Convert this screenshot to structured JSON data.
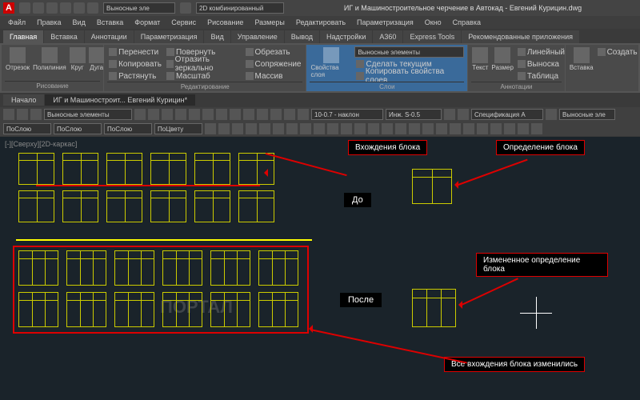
{
  "title": "ИГ и Машиностроительное черчение в Автокад - Евгений Курицин.dwg",
  "logo": "A",
  "qat_combo": "Выносные эле",
  "qat_combo2": "2D комбинированный",
  "menus": [
    "Файл",
    "Правка",
    "Вид",
    "Вставка",
    "Формат",
    "Сервис",
    "Рисование",
    "Размеры",
    "Редактировать",
    "Параметризация",
    "Окно",
    "Справка"
  ],
  "ribbon_tabs": [
    "Главная",
    "Вставка",
    "Аннотации",
    "Параметризация",
    "Вид",
    "Управление",
    "Вывод",
    "Надстройки",
    "A360",
    "Express Tools",
    "Рекомендованные приложения"
  ],
  "panels": {
    "draw": {
      "title": "Рисование",
      "btns": [
        "Отрезок",
        "Полилиния",
        "Круг",
        "Дуга"
      ]
    },
    "edit": {
      "title": "Редактирование",
      "rows": [
        "Перенести",
        "Копировать",
        "Растянуть",
        "Повернуть",
        "Отразить зеркально",
        "Масштаб",
        "Обрезать",
        "Сопряжение",
        "Массив"
      ]
    },
    "layers": {
      "title": "Слои",
      "btn": "Свойства слоя",
      "combo": "Выносные элементы",
      "rows": [
        "Сделать текущим",
        "Копировать свойства слоев"
      ]
    },
    "anno": {
      "title": "Аннотации",
      "btns": [
        "Текст",
        "Размер"
      ],
      "rows": [
        "Линейный",
        "Выноска",
        "Таблица"
      ]
    },
    "block": {
      "title": "",
      "btns": [
        "Вставка"
      ],
      "rows": [
        "Создать"
      ]
    }
  },
  "file_tabs": [
    "Начало",
    "ИГ и Машиностроит... Евгений Курицин*"
  ],
  "tb_combos": [
    "Выносные элементы",
    "10-0.7 - наклон",
    "Инж. S-0.5",
    "Спецификация A"
  ],
  "layer_combos": [
    "ПоСлою",
    "ПоСлою",
    "ПоСлою",
    "ПоЦвету"
  ],
  "tb_extra": "Выносные эле",
  "view_label": "[-][Сверху][2D-каркас]",
  "annotations": {
    "block_instances": "Вхождения блока",
    "block_def": "Определение блока",
    "before": "До",
    "after": "После",
    "changed_def": "Измененное определение блока",
    "all_changed": "Все вхождения блока изменились"
  },
  "watermark": "ПОРТАЛ"
}
